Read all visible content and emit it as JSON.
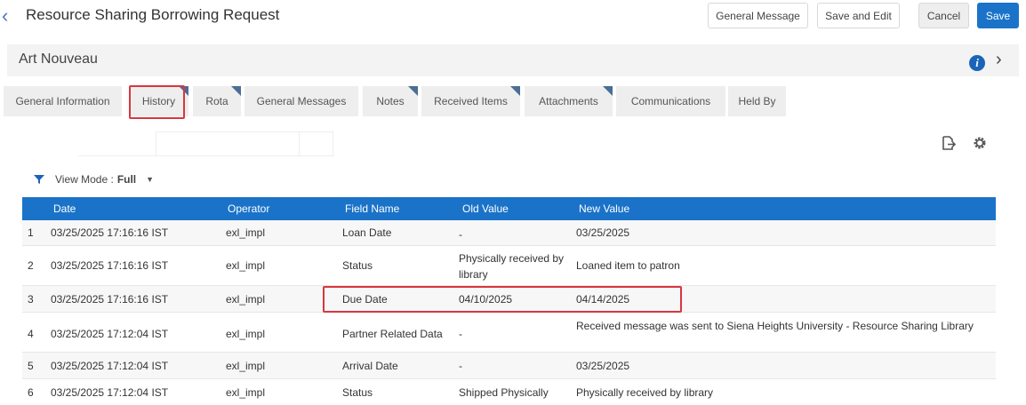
{
  "header": {
    "title": "Resource Sharing Borrowing Request",
    "buttons": {
      "general_message": "General Message",
      "save_and_edit": "Save and Edit",
      "cancel": "Cancel",
      "save": "Save"
    }
  },
  "record": {
    "title": "Art Nouveau"
  },
  "tabs": [
    {
      "label": "General Information",
      "has_content": false
    },
    {
      "label": "History",
      "has_content": true,
      "active": true
    },
    {
      "label": "Rota",
      "has_content": true
    },
    {
      "label": "General Messages",
      "has_content": false
    },
    {
      "label": "Notes",
      "has_content": true
    },
    {
      "label": "Received Items",
      "has_content": true
    },
    {
      "label": "Attachments",
      "has_content": true
    },
    {
      "label": "Communications",
      "has_content": false
    },
    {
      "label": "Held By",
      "has_content": false
    }
  ],
  "view_mode": {
    "label": "View Mode :",
    "value": "Full"
  },
  "table": {
    "columns": [
      "Date",
      "Operator",
      "Field Name",
      "Old Value",
      "New Value"
    ],
    "rows": [
      {
        "idx": "1",
        "date": "03/25/2025 17:16:16 IST",
        "operator": "exl_impl",
        "field": "Loan Date",
        "old": "-",
        "new": "03/25/2025"
      },
      {
        "idx": "2",
        "date": "03/25/2025 17:16:16 IST",
        "operator": "exl_impl",
        "field": "Status",
        "old": "Physically received by library",
        "new": "Loaned item to patron"
      },
      {
        "idx": "3",
        "date": "03/25/2025 17:16:16 IST",
        "operator": "exl_impl",
        "field": "Due Date",
        "old": "04/10/2025",
        "new": "04/14/2025"
      },
      {
        "idx": "4",
        "date": "03/25/2025 17:12:04 IST",
        "operator": "exl_impl",
        "field": "Partner Related Data",
        "old": "-",
        "new": "Received message was sent to Siena Heights University - Resource Sharing Library"
      },
      {
        "idx": "5",
        "date": "03/25/2025 17:12:04 IST",
        "operator": "exl_impl",
        "field": "Arrival Date",
        "old": "-",
        "new": "03/25/2025"
      },
      {
        "idx": "6",
        "date": "03/25/2025 17:12:04 IST",
        "operator": "exl_impl",
        "field": "Status",
        "old": "Shipped Physically",
        "new": "Physically received by library"
      }
    ]
  },
  "colors": {
    "primary": "#1a73c8",
    "highlight": "#d9363e",
    "tab_bg": "#eeeeee"
  }
}
